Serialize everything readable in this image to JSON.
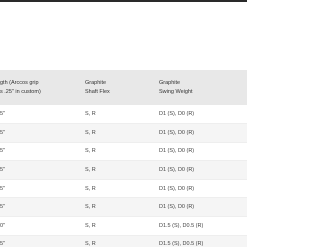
{
  "table": {
    "headers": [
      {
        "line1": "gth (Arccos grip",
        "line2": "s .25\" in custom)"
      },
      {
        "line1": "Graphite",
        "line2": "Shaft Flex"
      },
      {
        "line1": "Graphite",
        "line2": "Swing Weight"
      }
    ],
    "rows": [
      {
        "length": "5\"",
        "flex": "S, R",
        "swing": "D1 (S), D0 (R)"
      },
      {
        "length": "5\"",
        "flex": "S, R",
        "swing": "D1 (S), D0 (R)"
      },
      {
        "length": "5\"",
        "flex": "S, R",
        "swing": "D1 (S), D0 (R)"
      },
      {
        "length": "5\"",
        "flex": "S, R",
        "swing": "D1 (S), D0 (R)"
      },
      {
        "length": "5\"",
        "flex": "S, R",
        "swing": "D1 (S), D0 (R)"
      },
      {
        "length": "5\"",
        "flex": "S, R",
        "swing": "D1 (S), D0 (R)"
      },
      {
        "length": "0\"",
        "flex": "S, R",
        "swing": "D1.5 (S), D0.5 (R)"
      },
      {
        "length": "5\"",
        "flex": "S, R",
        "swing": "D1.5 (S), D0.5 (R)"
      }
    ]
  }
}
